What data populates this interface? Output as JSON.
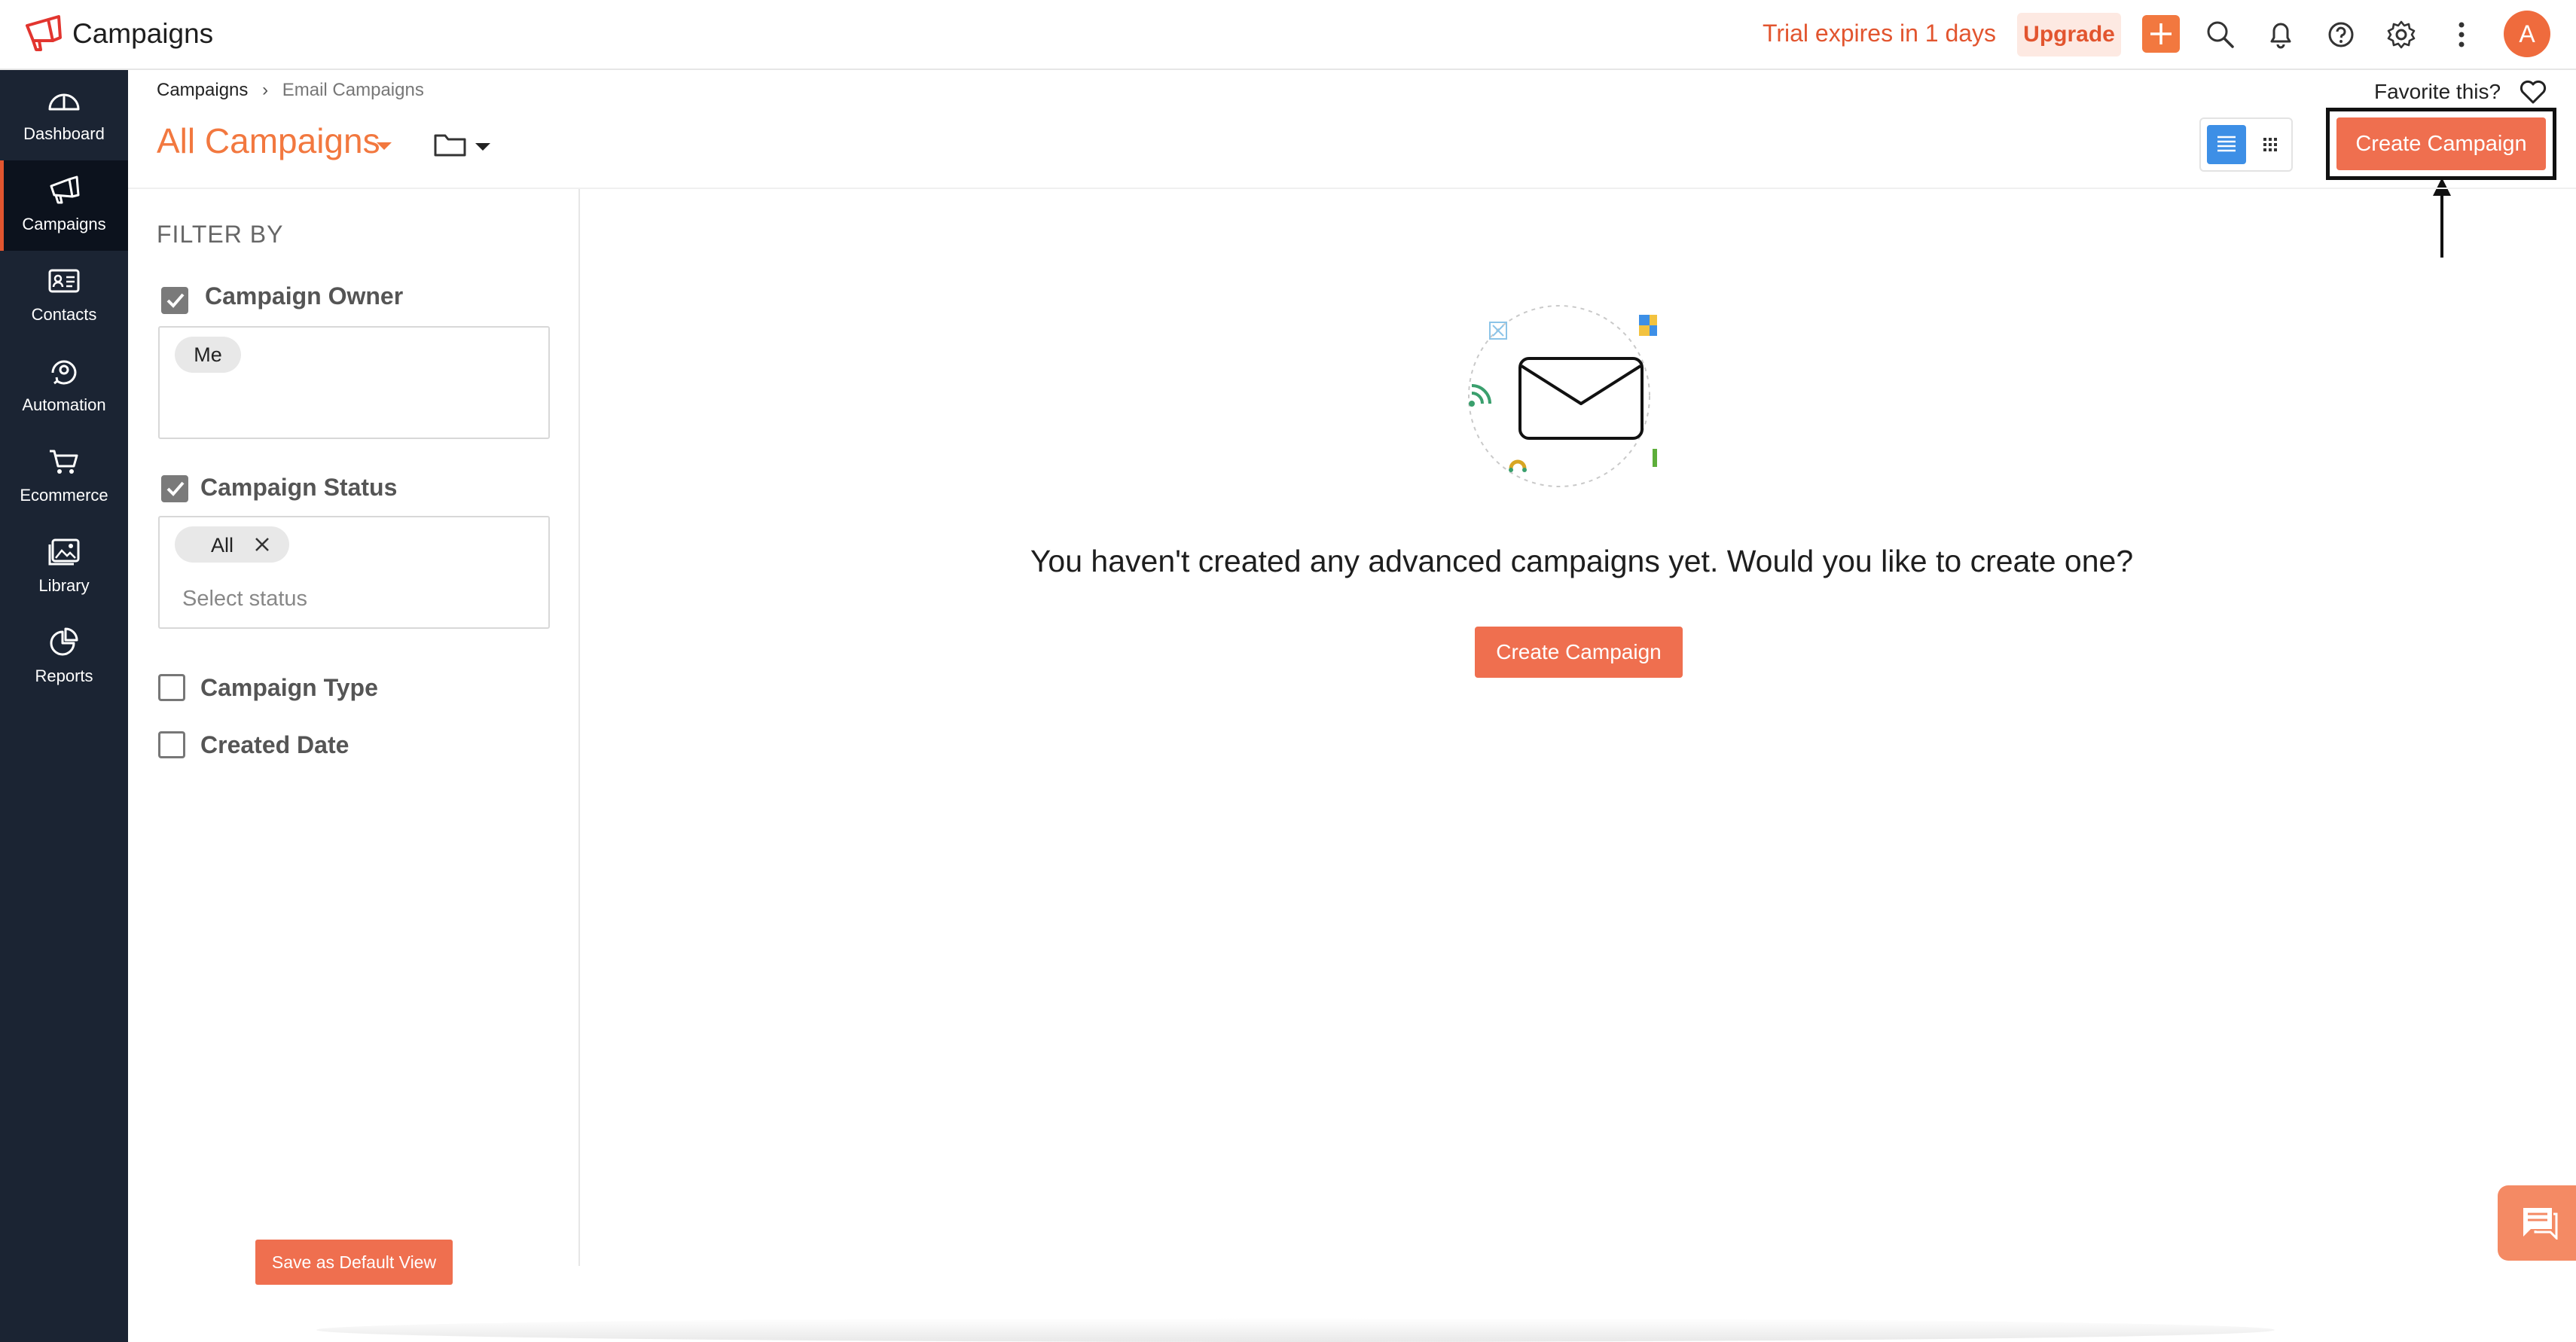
{
  "app": {
    "title": "Campaigns"
  },
  "topbar": {
    "trial_text": "Trial expires in 1 days",
    "upgrade_label": "Upgrade",
    "avatar_initial": "A",
    "accent_color": "#e2552f"
  },
  "nav": {
    "items": [
      {
        "label": "Dashboard",
        "icon": "gauge-icon",
        "active": false
      },
      {
        "label": "Campaigns",
        "icon": "megaphone-icon",
        "active": true
      },
      {
        "label": "Contacts",
        "icon": "contact-card-icon",
        "active": false
      },
      {
        "label": "Automation",
        "icon": "automation-icon",
        "active": false
      },
      {
        "label": "Ecommerce",
        "icon": "cart-icon",
        "active": false
      },
      {
        "label": "Library",
        "icon": "image-library-icon",
        "active": false
      },
      {
        "label": "Reports",
        "icon": "pie-chart-icon",
        "active": false
      }
    ]
  },
  "breadcrumb": {
    "root": "Campaigns",
    "separator": "›",
    "current": "Email Campaigns"
  },
  "header": {
    "title": "All Campaigns",
    "favorite_text": "Favorite this?",
    "create_label": "Create Campaign",
    "view_mode": "list"
  },
  "filters": {
    "heading": "FILTER BY",
    "owner": {
      "label": "Campaign Owner",
      "checked": true,
      "chip": "Me"
    },
    "status": {
      "label": "Campaign Status",
      "checked": true,
      "chip": "All",
      "placeholder": "Select status"
    },
    "type": {
      "label": "Campaign Type",
      "checked": false
    },
    "date": {
      "label": "Created Date",
      "checked": false
    },
    "save_default_label": "Save as Default View"
  },
  "main": {
    "empty_message": "You haven't created any advanced campaigns yet. Would you like to create one?",
    "create_label": "Create Campaign"
  }
}
